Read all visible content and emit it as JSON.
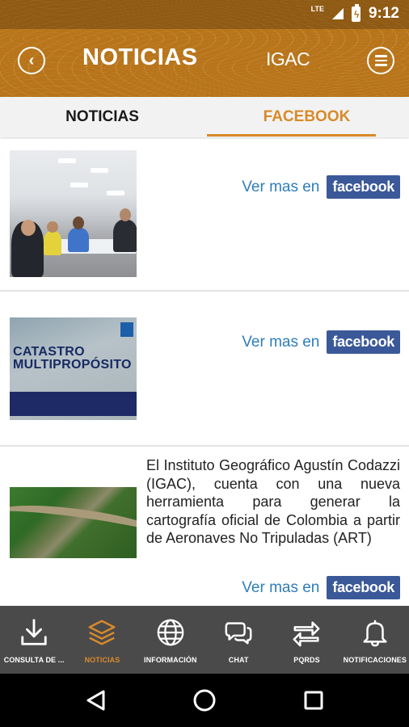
{
  "status_bar": {
    "network": "LTE",
    "time": "9:12"
  },
  "header": {
    "title": "NOTICIAS",
    "brand": "IGAC"
  },
  "tabs": [
    {
      "label": "NOTICIAS",
      "active": false
    },
    {
      "label": "FACEBOOK",
      "active": true
    }
  ],
  "items": [
    {
      "image": "meeting-photo",
      "text": "",
      "link_label": "Ver mas en",
      "logo_text": "facebook"
    },
    {
      "image": "catastro-poster",
      "poster_title_1": "CATASTRO",
      "poster_title_2": "MULTIPROPÓSITO",
      "text": "",
      "link_label": "Ver mas en",
      "logo_text": "facebook"
    },
    {
      "image": "aerial-photo",
      "text": "El Instituto Geográfico Agustín Codazzi (IGAC), cuenta con una nueva herramienta para generar la cartografía oficial de Colombia a partir de Aeronaves No Tripuladas (ART)",
      "link_label": "Ver mas en",
      "logo_text": "facebook"
    }
  ],
  "bottom_nav": [
    {
      "label": "CONSULTA DE ...",
      "icon": "download-icon",
      "active": false
    },
    {
      "label": "NOTICIAS",
      "icon": "layers-icon",
      "active": true
    },
    {
      "label": "INFORMACIÓN",
      "icon": "globe-icon",
      "active": false
    },
    {
      "label": "CHAT",
      "icon": "chat-icon",
      "active": false
    },
    {
      "label": "PQRDS",
      "icon": "swap-arrows-icon",
      "active": false
    },
    {
      "label": "NOTIFICACIONES",
      "icon": "bell-icon",
      "active": false
    }
  ],
  "colors": {
    "header": "#b8741a",
    "accent": "#d78a28",
    "link": "#2e7dbb",
    "facebook": "#3b5998",
    "nav_bg": "#4a4a4a"
  }
}
